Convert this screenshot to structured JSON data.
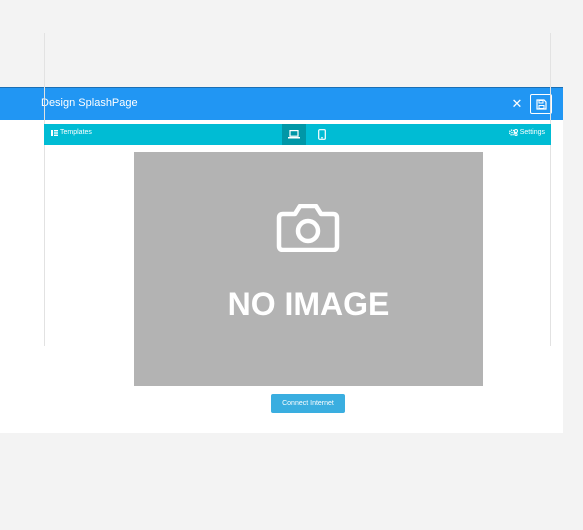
{
  "modal": {
    "title": "Design SplashPage",
    "close_icon": "close-icon",
    "save_icon": "save-icon"
  },
  "toolbar": {
    "templates_label": "Templates",
    "settings_label": "Settings",
    "desktop_icon": "laptop-icon",
    "mobile_icon": "mobile-icon",
    "active_view": "desktop"
  },
  "preview": {
    "placeholder_text": "NO IMAGE",
    "placeholder_icon": "camera-icon",
    "connect_button_label": "Connect Internet"
  },
  "colors": {
    "header": "#2196f3",
    "toolbar": "#00bcd4",
    "toolbar_active": "#0097a7",
    "connect_button": "#3aaee0",
    "placeholder": "#b3b3b3"
  }
}
